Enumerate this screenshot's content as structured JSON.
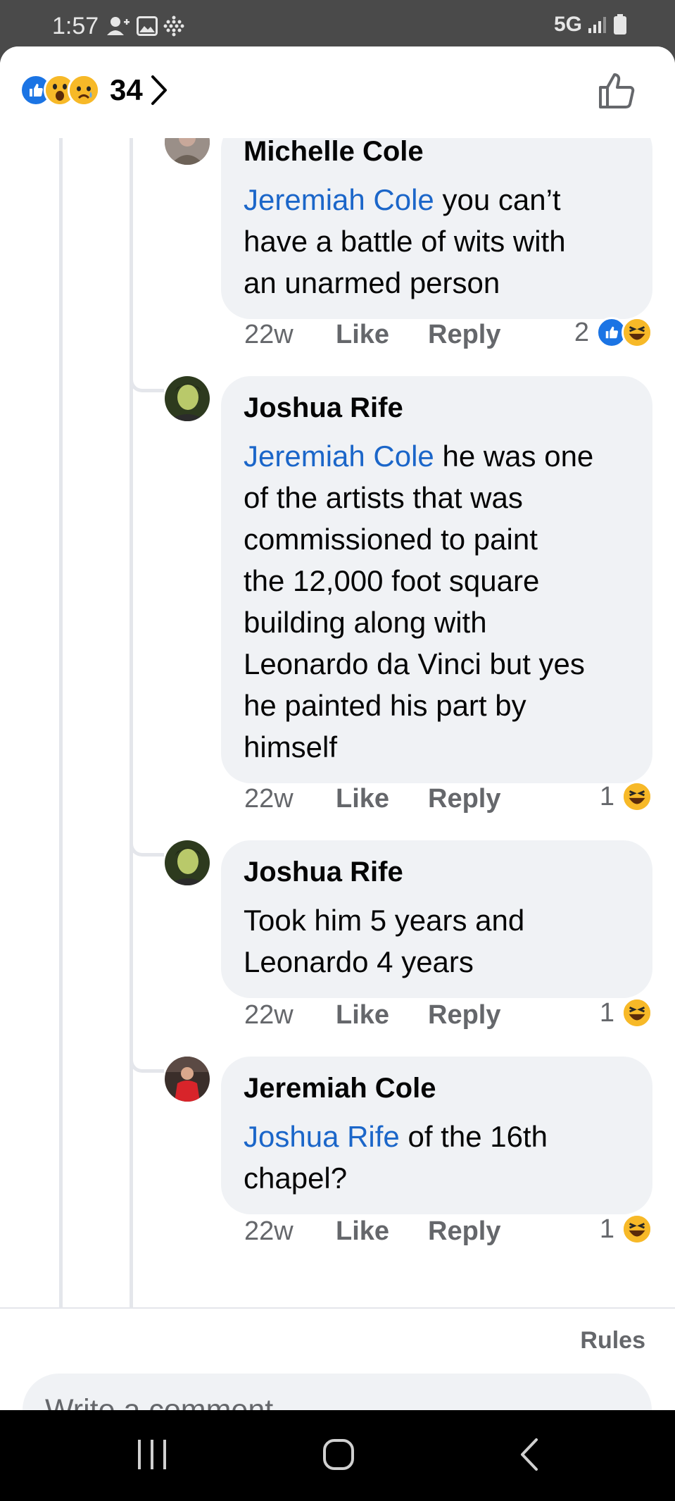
{
  "status_bar": {
    "time": "1:57",
    "network": "5G"
  },
  "header": {
    "reaction_count": "34"
  },
  "comments": [
    {
      "author": "Michelle Cole",
      "mention": "Jeremiah Cole",
      "text_lines": [
        " you can’t",
        "have a battle of wits with",
        "an unarmed person"
      ],
      "time": "22w",
      "like": "Like",
      "reply": "Reply",
      "reaction_count": "2"
    },
    {
      "author": "Joshua Rife",
      "mention": "Jeremiah Cole",
      "text_lines": [
        " he was one",
        "of the artists that was",
        "commissioned to paint",
        "the 12,000 foot square",
        "building along with",
        "Leonardo da Vinci but yes",
        "he painted his part by",
        "himself"
      ],
      "time": "22w",
      "like": "Like",
      "reply": "Reply",
      "reaction_count": "1"
    },
    {
      "author": "Joshua Rife",
      "mention": "",
      "text_lines": [
        "Took him 5 years and",
        "Leonardo 4 years"
      ],
      "time": "22w",
      "like": "Like",
      "reply": "Reply",
      "reaction_count": "1"
    },
    {
      "author": "Jeremiah Cole",
      "mention": "Joshua Rife",
      "text_lines": [
        " of the 16th",
        "chapel?"
      ],
      "time": "22w",
      "like": "Like",
      "reply": "Reply",
      "reaction_count": "1"
    }
  ],
  "composer": {
    "rules_label": "Rules",
    "placeholder": "Write a comment…"
  },
  "icons": {
    "header_reactions": [
      "like-reaction-icon",
      "wow-reaction-icon",
      "sad-reaction-icon"
    ],
    "comment_reactions": [
      "like-reaction-icon",
      "haha-reaction-icon"
    ],
    "nav": [
      "recent-apps-icon",
      "home-icon",
      "back-icon"
    ]
  },
  "colors": {
    "accent": "#1b74e4",
    "mention": "#1b66c9",
    "bubble": "#f0f2f5",
    "muted_text": "#65676b"
  }
}
